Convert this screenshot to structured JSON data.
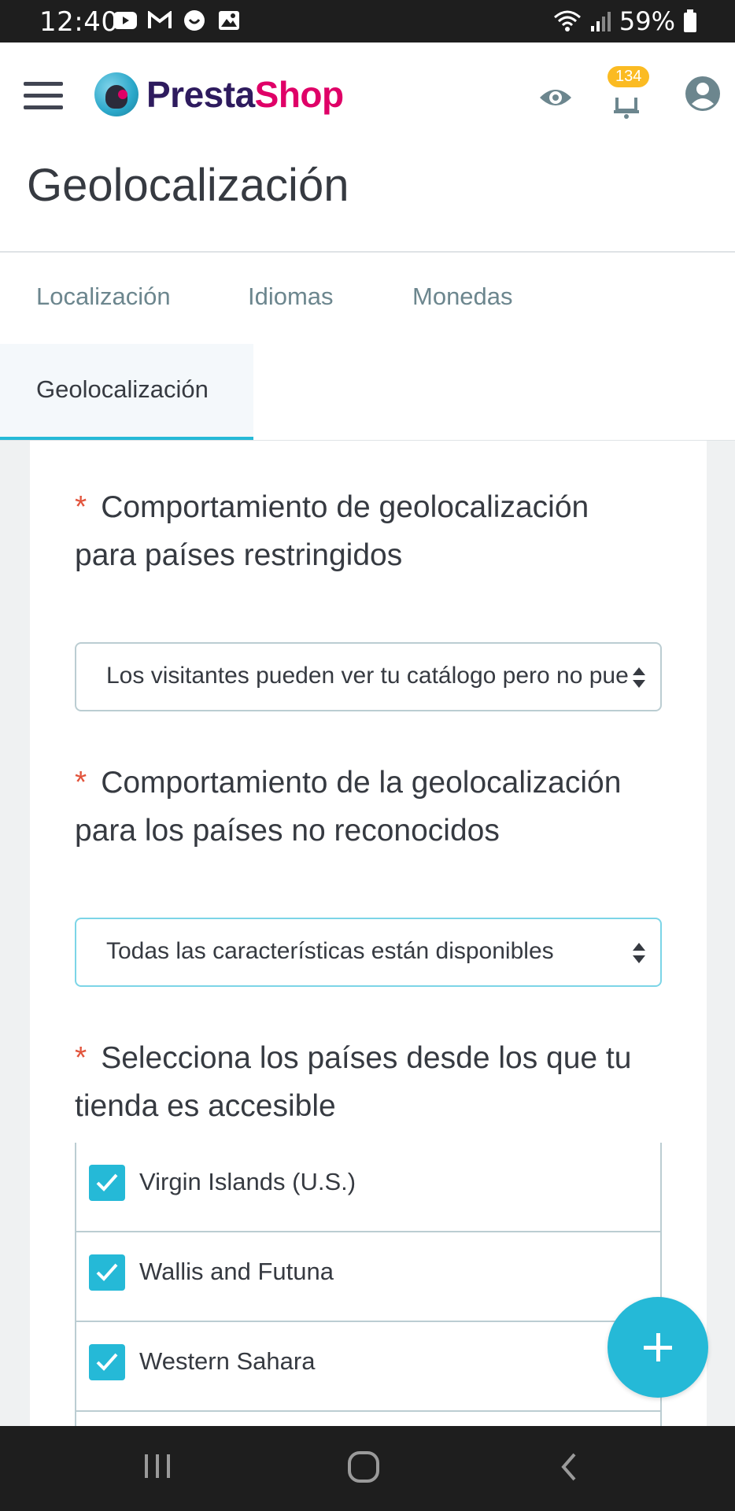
{
  "status_bar": {
    "time": "12:40",
    "battery": "59%",
    "icons": [
      "youtube-icon",
      "gmail-icon",
      "face-icon",
      "image-icon"
    ]
  },
  "header": {
    "logo_part1": "Presta",
    "logo_part2": "Shop",
    "notifications_count": "134",
    "colors": {
      "brand_dark": "#2e1b5e",
      "brand_pink": "#df0067",
      "accent": "#25b9d7",
      "badge": "#fbbb22"
    }
  },
  "page": {
    "title": "Geolocalización"
  },
  "tabs": [
    {
      "label": "Localización"
    },
    {
      "label": "Idiomas"
    },
    {
      "label": "Monedas"
    },
    {
      "label": "Geolocalización",
      "active": true
    }
  ],
  "form": {
    "required_mark": "*",
    "restricted": {
      "label": "Comportamiento de geolocalización para países restringidos",
      "value": "Los visitantes pueden ver tu catálogo pero no pueden realizar un pedido."
    },
    "unrecognized": {
      "label": "Comportamiento de la geolocalización para los países no reconocidos",
      "value": "Todas las características están disponibles"
    },
    "countries": {
      "label": "Selecciona los países desde los que tu tienda es accesible",
      "items": [
        {
          "name": "Virgin Islands (U.S.)",
          "checked": true
        },
        {
          "name": "Wallis and Futuna",
          "checked": true
        },
        {
          "name": "Western Sahara",
          "checked": true
        }
      ]
    }
  }
}
